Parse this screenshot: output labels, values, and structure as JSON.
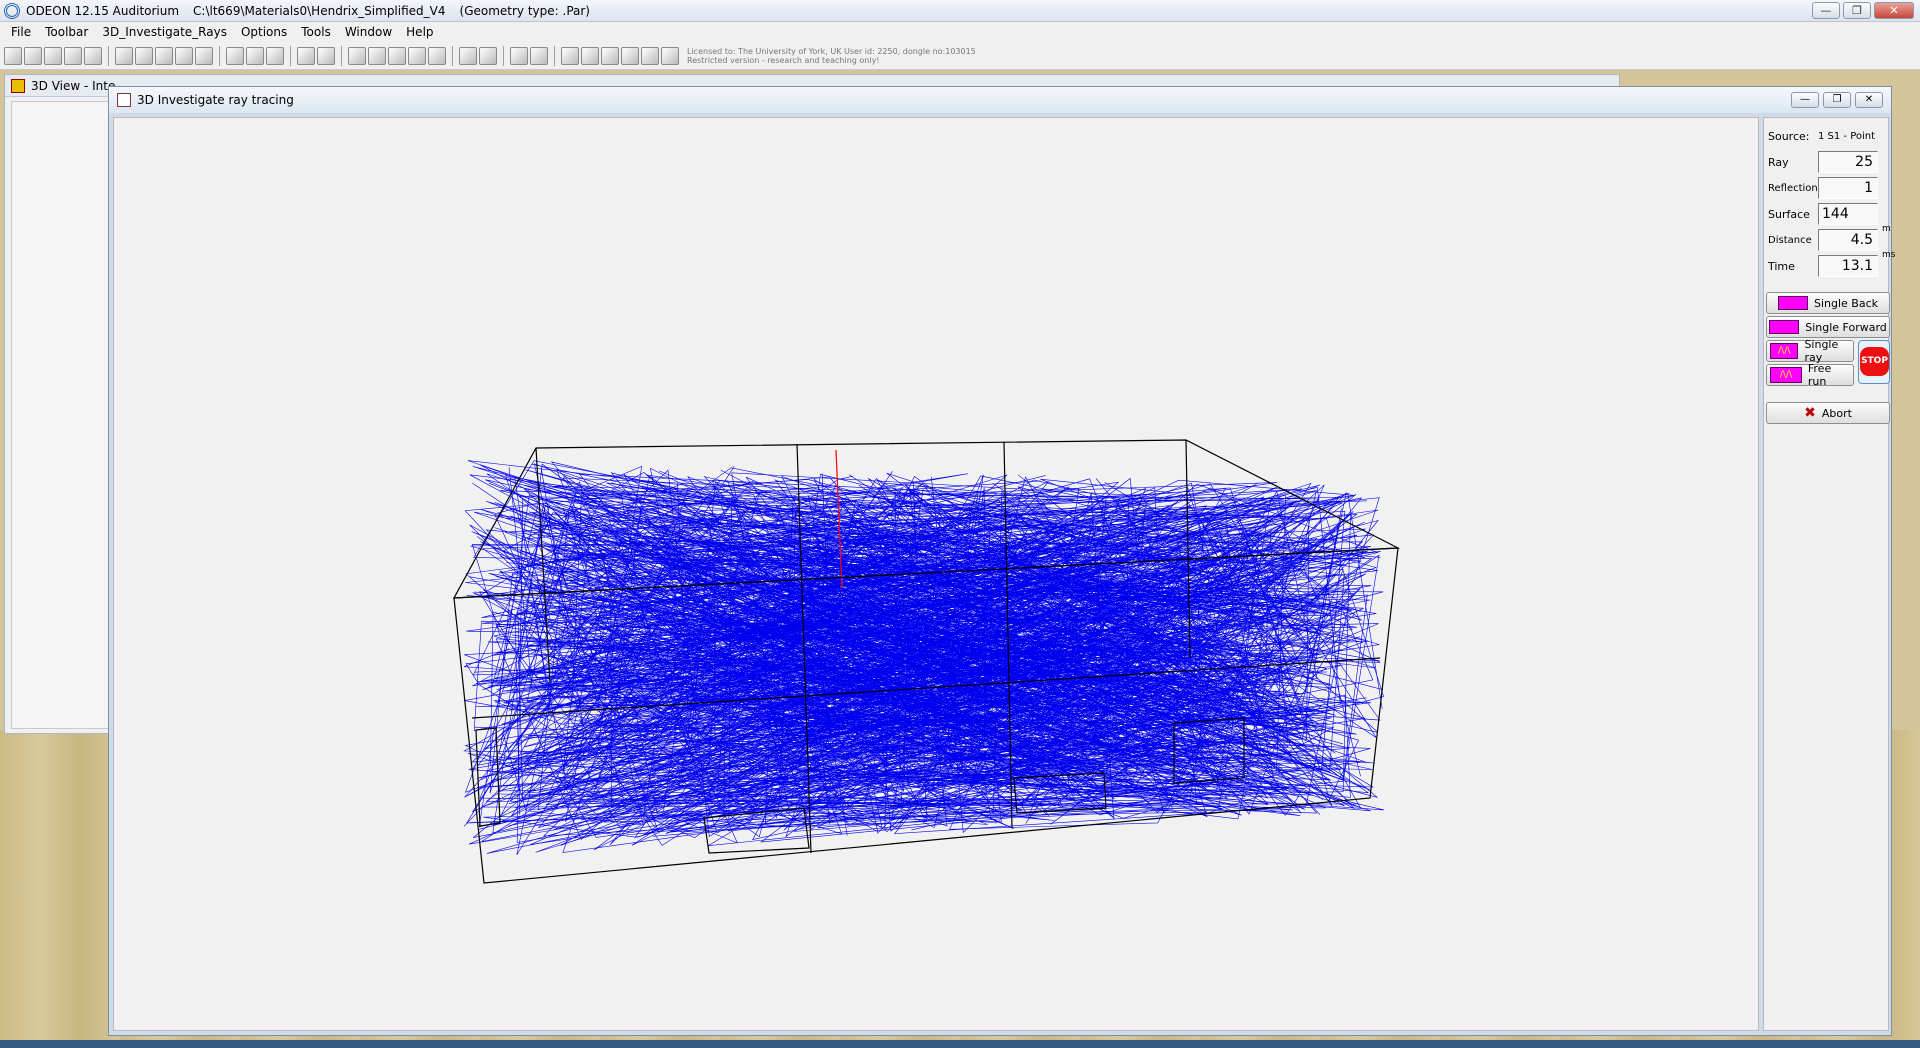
{
  "app": {
    "title": "ODEON 12.15 Auditorium",
    "path": "C:\\lt669\\Materials0\\Hendrix_Simplified_V4",
    "geometry_type": "(Geometry type: .Par)",
    "controls": {
      "minimize": "—",
      "restore": "❐",
      "close": "✕"
    }
  },
  "menu": [
    "File",
    "Toolbar",
    "3D_Investigate_Rays",
    "Options",
    "Tools",
    "Window",
    "Help"
  ],
  "license": {
    "line1": "Licensed to: The University of York, UK   User id: 2250, dongle no:103015",
    "line2": "Restricted version - research and teaching only!"
  },
  "background_window": {
    "title": "3D View - Inte"
  },
  "main_window": {
    "title": "3D Investigate ray tracing",
    "controls": {
      "minimize": "—",
      "restore": "❐",
      "close": "✕"
    }
  },
  "panel": {
    "source_label": "Source:",
    "source_value": "1 S1  - Point",
    "ray_label": "Ray",
    "ray_value": "25",
    "reflection_label": "Reflection",
    "reflection_value": "1",
    "surface_label": "Surface",
    "surface_value": "144",
    "distance_label": "Distance",
    "distance_value": "4.5",
    "distance_unit": "m",
    "time_label": "Time",
    "time_value": "13.1",
    "time_unit": "ms",
    "buttons": {
      "single_back": "Single Back",
      "single_forward": "Single Forward",
      "single_ray": "Single ray",
      "free_run": "Free run",
      "stop": "STOP",
      "abort": "Abort"
    }
  },
  "colors": {
    "rays": "#0000ee",
    "current_ray": "#ff0000",
    "wireframe": "#000000",
    "pink": "#ff00ff"
  }
}
